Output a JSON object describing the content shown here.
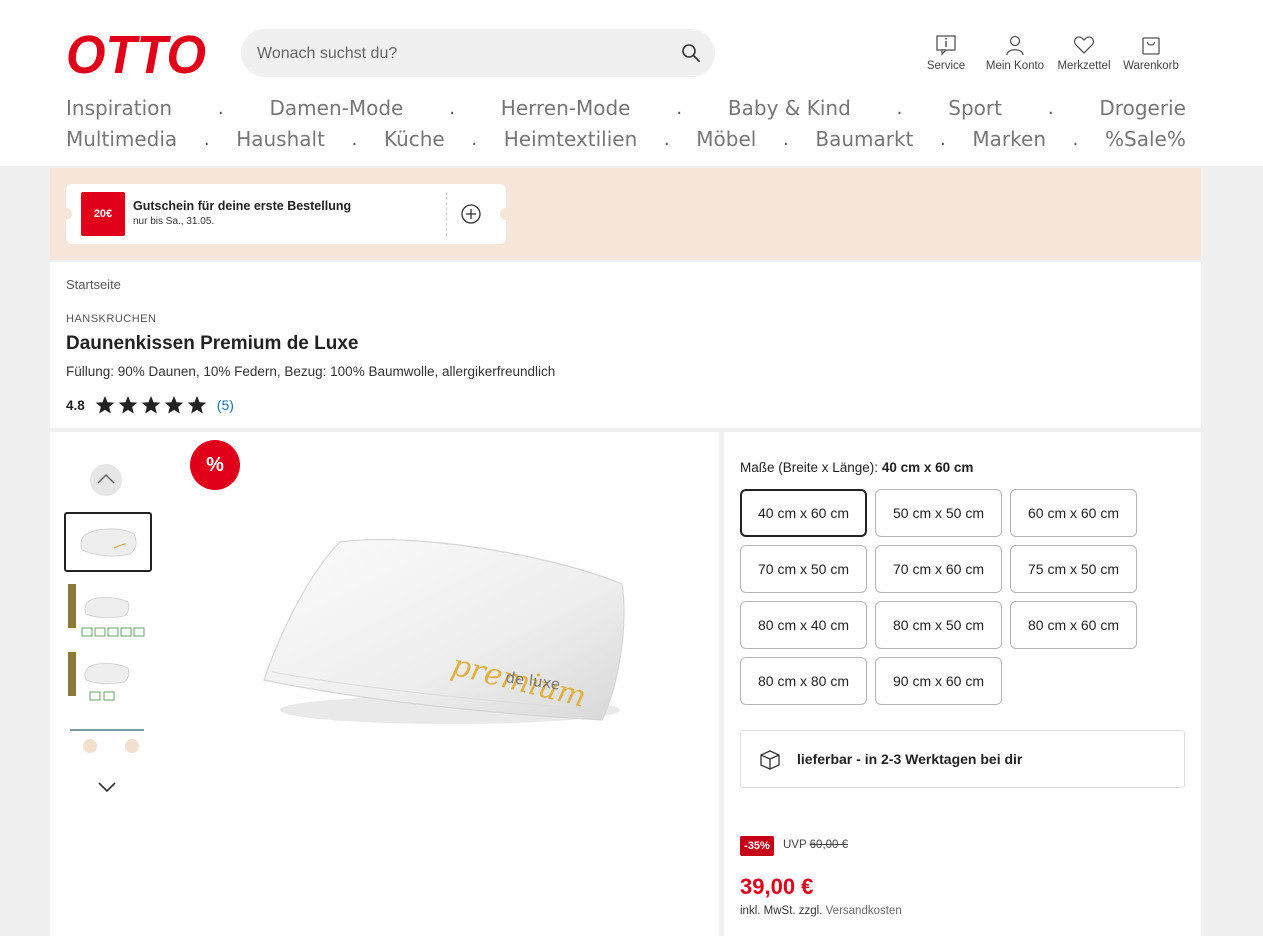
{
  "header": {
    "logo_text": "OTTO",
    "search": {
      "placeholder": "Wonach suchst du?"
    },
    "icons": [
      {
        "name": "service-icon",
        "label": "Service"
      },
      {
        "name": "account-icon",
        "label": "Mein Konto"
      },
      {
        "name": "heart-icon",
        "label": "Merkzettel"
      },
      {
        "name": "cart-icon",
        "label": "Warenkorb"
      }
    ],
    "nav_row1": [
      "Inspiration",
      "Damen-Mode",
      "Herren-Mode",
      "Baby & Kind",
      "Sport",
      "Drogerie"
    ],
    "nav_row2": [
      "Multimedia",
      "Haushalt",
      "Küche",
      "Heimtextilien",
      "Möbel",
      "Baumarkt",
      "Marken",
      "%Sale%"
    ],
    "separator": "."
  },
  "voucher": {
    "badge": "20€",
    "title": "Gutschein für deine erste Bestellung",
    "subtitle": "nur bis Sa., 31.05.",
    "add_icon": "plus-circle-icon"
  },
  "product": {
    "breadcrumb": "Startseite",
    "brand": "HANSKRUCHEN",
    "title": "Daunenkissen Premium de Luxe",
    "subtitle": "Füllung: 90% Daunen, 10% Federn, Bezug: 100% Baumwolle, allergikerfreundlich",
    "rating": "4.8",
    "rating_stars": 5,
    "rating_count": "(5)"
  },
  "gallery": {
    "sale_badge": "%",
    "image_text_1": "premium",
    "image_text_2": "de luxe"
  },
  "buybox": {
    "size_label": "Maße (Breite x Länge):",
    "size_selected": "40 cm x 60 cm",
    "sizes": [
      "40 cm x 60 cm",
      "50 cm x 50 cm",
      "60 cm x 60 cm",
      "70 cm x 50 cm",
      "70 cm x 60 cm",
      "75 cm x 50 cm",
      "80 cm x 40 cm",
      "80 cm x 50 cm",
      "80 cm x 60 cm",
      "80 cm x 80 cm",
      "90 cm x 60 cm"
    ],
    "delivery": "lieferbar - in 2-3 Werktagen bei dir",
    "discount": "-35%",
    "uvp_label": "UVP",
    "uvp_price": "60,00 €",
    "price": "39,00 €",
    "tax_text": "inkl. MwSt. zzgl.",
    "shipping_link": "Versandkosten"
  },
  "colors": {
    "brand_red": "#e10019",
    "discount_red": "#c60018",
    "link_blue": "#1a6fb8",
    "banner_bg": "#f5e6d9"
  }
}
